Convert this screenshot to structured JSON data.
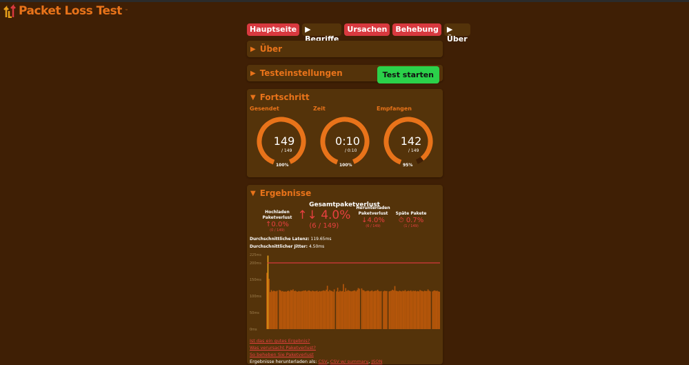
{
  "app": {
    "title": "Packet Loss Test",
    "tm": "™"
  },
  "nav": [
    {
      "label": "Hauptseite",
      "style": "red"
    },
    {
      "label": "Begriffe",
      "style": "dk",
      "arrow": true
    },
    {
      "label": "Ursachen",
      "style": "red"
    },
    {
      "label": "Behebung",
      "style": "red"
    },
    {
      "label": "Über",
      "style": "dk",
      "arrow": true
    }
  ],
  "sections": {
    "about": "Über",
    "settings": "Testeinstellungen",
    "start": "Test starten",
    "progress": "Fortschritt",
    "results": "Ergebnisse"
  },
  "gauges": [
    {
      "label": "Gesendet",
      "value": "149",
      "sub": "/ 149",
      "pct": "100%",
      "fraction": 1.0
    },
    {
      "label": "Zeit",
      "value": "0:10",
      "sub": "/ 0:10",
      "pct": "100%",
      "fraction": 1.0
    },
    {
      "label": "Empfangen",
      "value": "142",
      "sub": "/ 149",
      "pct": "95%",
      "fraction": 0.95
    }
  ],
  "results": {
    "total_title": "Gesamtpaketverlust",
    "upload": {
      "h1": "Hochladen",
      "h2": "Paketverlust",
      "value": "↑0.0%",
      "count": "(0 / 149)"
    },
    "total": {
      "value": "↑↓ 4.0%",
      "count": "(6 / 149)"
    },
    "download": {
      "h1": "Herunterladen",
      "h2": "Paketverlust",
      "value": "↓4.0%",
      "count": "(6 / 149)"
    },
    "late": {
      "h1": "",
      "h2": "Späte Pakete",
      "value": "⏱ 0.7%",
      "count": "(1 / 149)"
    },
    "latency_label": "Durchschnittliche Latenz:",
    "latency": "119.65ms",
    "jitter_label": "Durchschnittlicher Jitter:",
    "jitter": "4.50ms"
  },
  "links": [
    "Ist das ein gutes Ergebnis?",
    "Was verursacht Paketverlust?",
    "So beheben Sie Paketverlust"
  ],
  "download": {
    "label": "Ergebnisse herunterladen als:",
    "formats": [
      "CSV",
      "CSV w/ summary",
      "JSON"
    ]
  },
  "chart_data": {
    "type": "bar",
    "ylabel": "ms",
    "yticks": [
      "0ms",
      "50ms",
      "100ms",
      "150ms",
      "200ms",
      "225ms"
    ],
    "ylim": [
      0,
      225
    ],
    "threshold": 200,
    "late_index": 1,
    "values": [
      170,
      222,
      152,
      112,
      118,
      114,
      116,
      115,
      114,
      116,
      null,
      118,
      117,
      114,
      115,
      113,
      114,
      113,
      115,
      116,
      114,
      118,
      117,
      120,
      115,
      116,
      114,
      113,
      115,
      114,
      114,
      115,
      116,
      116,
      117,
      114,
      116,
      117,
      115,
      114,
      116,
      115,
      114,
      115,
      116,
      113,
      115,
      114,
      115,
      116,
      117,
      115,
      119,
      131,
      114,
      118,
      116,
      115,
      113,
      120,
      null,
      114,
      125,
      113,
      116,
      114,
      115,
      136,
      113,
      124,
      115,
      118,
      116,
      115,
      114,
      115,
      116,
      117,
      114,
      118,
      124,
      122,
      null,
      123,
      118,
      117,
      114,
      115,
      116,
      116,
      114,
      115,
      117,
      114,
      115,
      116,
      116,
      119,
      115,
      114,
      115,
      null,
      114,
      116,
      115,
      115,
      null,
      114,
      115,
      116,
      119,
      117,
      130,
      116,
      115,
      114,
      116,
      115,
      114,
      116,
      115,
      118,
      114,
      115,
      116,
      115,
      117,
      114,
      116,
      115,
      116,
      114,
      115,
      114,
      118,
      116,
      115,
      114,
      116,
      115,
      115,
      120,
      116,
      114,
      null,
      114,
      116,
      117,
      115,
      116,
      114,
      113
    ]
  },
  "colors": {
    "accent": "#e8731a",
    "red": "#d8393f",
    "panel": "#54330a",
    "bg": "#3f1f05",
    "green": "#2bd14a"
  }
}
